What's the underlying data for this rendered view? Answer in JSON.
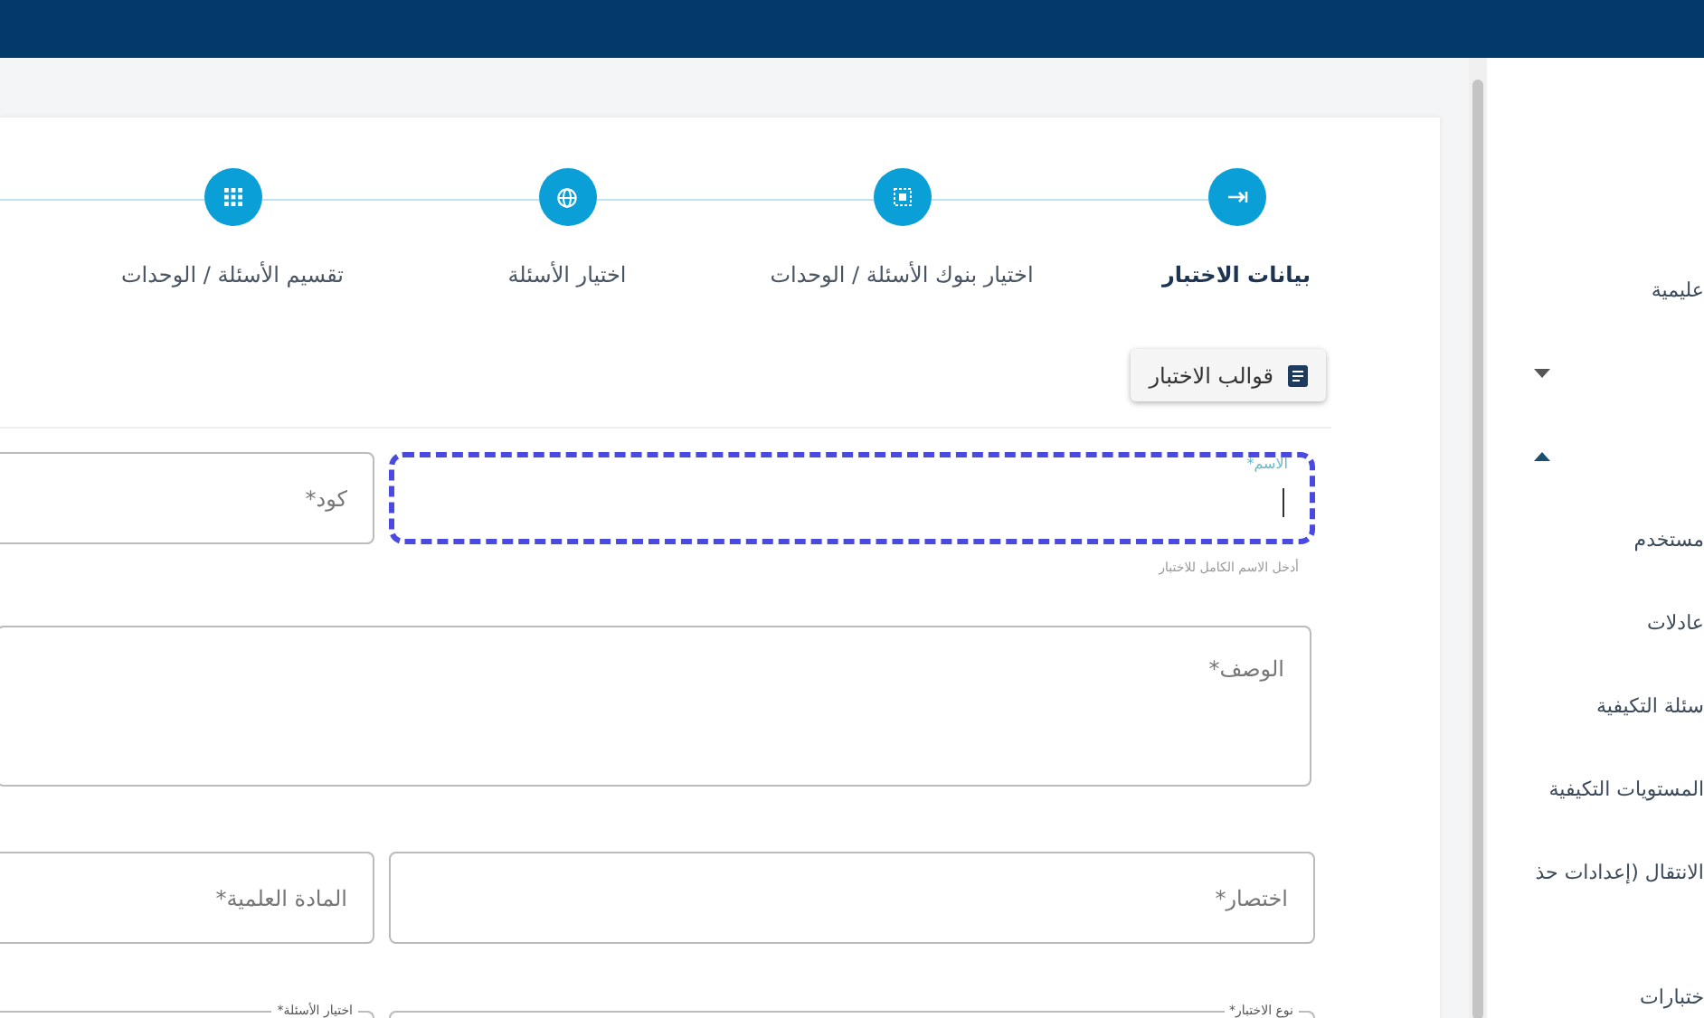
{
  "steps": [
    {
      "label": "بيانات الاختبار",
      "selected": true
    },
    {
      "label": "اختيار بنوك الأسئلة / الوحدات",
      "selected": false
    },
    {
      "label": "اختيار الأسئلة",
      "selected": false
    },
    {
      "label": "تقسيم الأسئلة / الوحدات",
      "selected": false
    }
  ],
  "templates_button": {
    "label": "قوالب الاختبار"
  },
  "form": {
    "name_field": {
      "label": "الاسم*",
      "hint": "أدخل الاسم الكامل للاختبار",
      "focused": true
    },
    "code_field": {
      "placeholder": "كود*"
    },
    "description_field": {
      "placeholder": "الوصف*"
    },
    "abbreviation_field": {
      "placeholder": "اختصار*"
    },
    "subject_field": {
      "placeholder": "المادة العلمية*"
    },
    "test_type_field": {
      "label": "نوع الاختبار*"
    },
    "question_selection_field": {
      "label": "اختيار الأسئلة*"
    }
  },
  "sidebar": {
    "items": [
      {
        "kind": "link",
        "label": "عليمية"
      },
      {
        "kind": "group",
        "expanded": false
      },
      {
        "kind": "group",
        "expanded": true
      },
      {
        "kind": "link",
        "label": "مستخدم"
      },
      {
        "kind": "link",
        "label": "عادلات"
      },
      {
        "kind": "link",
        "label": "سئلة التكيفية"
      },
      {
        "kind": "link",
        "label": "المستويات التكيفية"
      },
      {
        "kind": "link",
        "label": "الانتقال (إعدادات حذ"
      },
      {
        "kind": "link",
        "label": "ختبارات"
      }
    ]
  }
}
